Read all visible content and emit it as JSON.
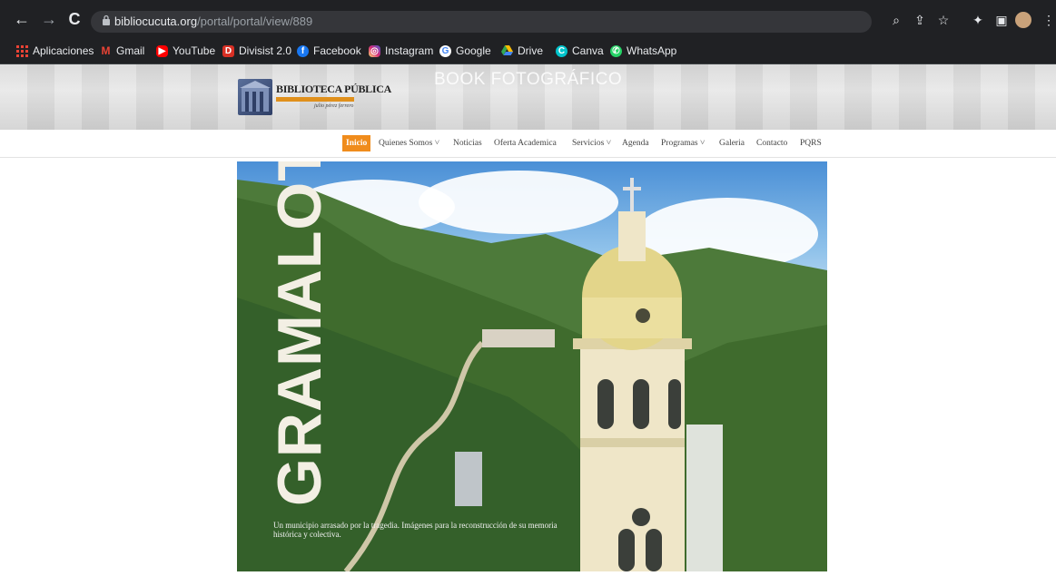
{
  "browser": {
    "url_host": "bibliocucuta.org",
    "url_path": "/portal/portal/view/889",
    "bookmarks": [
      {
        "label": "Aplicaciones",
        "icon": "apps-grid-icon",
        "color": "#ea4335"
      },
      {
        "label": "Gmail",
        "icon": "gmail-icon",
        "color": "#ea4335"
      },
      {
        "label": "YouTube",
        "icon": "youtube-icon",
        "color": "#ff0000"
      },
      {
        "label": "Divisist 2.0",
        "icon": "divisist-icon",
        "color": "#d93025"
      },
      {
        "label": "Facebook",
        "icon": "facebook-icon",
        "color": "#1877f2"
      },
      {
        "label": "Instagram",
        "icon": "instagram-icon",
        "color": "#d62976"
      },
      {
        "label": "Google",
        "icon": "google-icon",
        "color": "#4285f4"
      },
      {
        "label": "Drive",
        "icon": "drive-icon",
        "color": "#34a853"
      },
      {
        "label": "Canva",
        "icon": "canva-icon",
        "color": "#00c4cc"
      },
      {
        "label": "WhatsApp",
        "icon": "whatsapp-icon",
        "color": "#25d366"
      }
    ]
  },
  "site": {
    "logo_title": "BIBLIOTECA PÚBLICA",
    "logo_tagline": "julio pérez ferrero",
    "banner_text": "BOOK FOTOGRÁFICO",
    "accent": "#f08c1c",
    "nav": [
      {
        "label": "Inicio"
      },
      {
        "label": "Quienes Somos ˅"
      },
      {
        "label": "Noticias"
      },
      {
        "label": "Oferta Academica"
      },
      {
        "label": "Servicios ˅"
      },
      {
        "label": "Agenda"
      },
      {
        "label": "Programas ˅"
      },
      {
        "label": "Galeria"
      },
      {
        "label": "Contacto"
      },
      {
        "label": "PQRS"
      }
    ]
  },
  "hero": {
    "title": "GRAMALOTE",
    "caption": "Un municipio arrasado por la tragedia. Imágenes para la reconstrucción de su memoria histórica y colectiva."
  }
}
